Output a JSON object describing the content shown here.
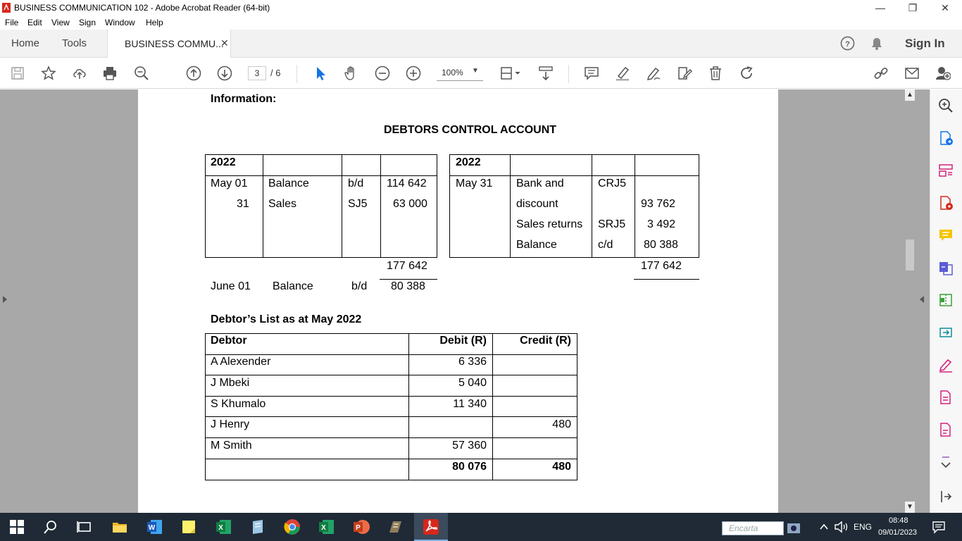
{
  "window": {
    "title": "BUSINESS COMMUNICATION 102 - Adobe Acrobat Reader (64-bit)"
  },
  "menu": [
    "File",
    "Edit",
    "View",
    "Sign",
    "Window",
    "Help"
  ],
  "tabs": {
    "home": "Home",
    "tools": "Tools",
    "doc": "BUSINESS COMMU..."
  },
  "sign_in": "Sign In",
  "toolbar": {
    "page_current": "3",
    "page_total": "/ 6",
    "zoom": "100%"
  },
  "document": {
    "info_heading": "Information:",
    "account_title": "DEBTORS CONTROL ACCOUNT",
    "debit_side": {
      "year": "2022",
      "rows": [
        {
          "date": "May 01",
          "detail": "Balance",
          "folio": "b/d",
          "amount": "114 642"
        },
        {
          "date": "31",
          "detail": "Sales",
          "folio": "SJ5",
          "amount": "63 000"
        }
      ],
      "total": "177 642"
    },
    "credit_side": {
      "year": "2022",
      "date": "May 31",
      "rows": [
        {
          "detail": "Bank and",
          "folio": "CRJ5",
          "amount": ""
        },
        {
          "detail": "discount",
          "folio": "",
          "amount": "93 762"
        },
        {
          "detail": "Sales returns",
          "folio": "SRJ5",
          "amount": "3 492"
        },
        {
          "detail": "Balance",
          "folio": "c/d",
          "amount": "80 388"
        }
      ],
      "total": "177 642"
    },
    "carried": {
      "date": "June 01",
      "detail": "Balance",
      "folio": "b/d",
      "amount": "80 388"
    },
    "list_heading": "Debtor’s List as at May 2022",
    "list_headers": {
      "debtor": "Debtor",
      "debit": "Debit (R)",
      "credit": "Credit (R)"
    },
    "list_rows": [
      {
        "debtor": "A Alexender",
        "debit": "6 336",
        "credit": ""
      },
      {
        "debtor": "J Mbeki",
        "debit": "5 040",
        "credit": ""
      },
      {
        "debtor": "S Khumalo",
        "debit": "11 340",
        "credit": ""
      },
      {
        "debtor": "J Henry",
        "debit": "",
        "credit": "480"
      },
      {
        "debtor": "M Smith",
        "debit": "57 360",
        "credit": ""
      }
    ],
    "list_totals": {
      "debit": "80 076",
      "credit": "480"
    }
  },
  "taskbar": {
    "search_placeholder": "Encarta",
    "time": "08:48",
    "date": "09/01/2023",
    "lang": "ENG"
  },
  "colors": {
    "accent_blue": "#1473e6",
    "acrobat_red": "#d6281b",
    "tool_pink": "#d4237a"
  }
}
